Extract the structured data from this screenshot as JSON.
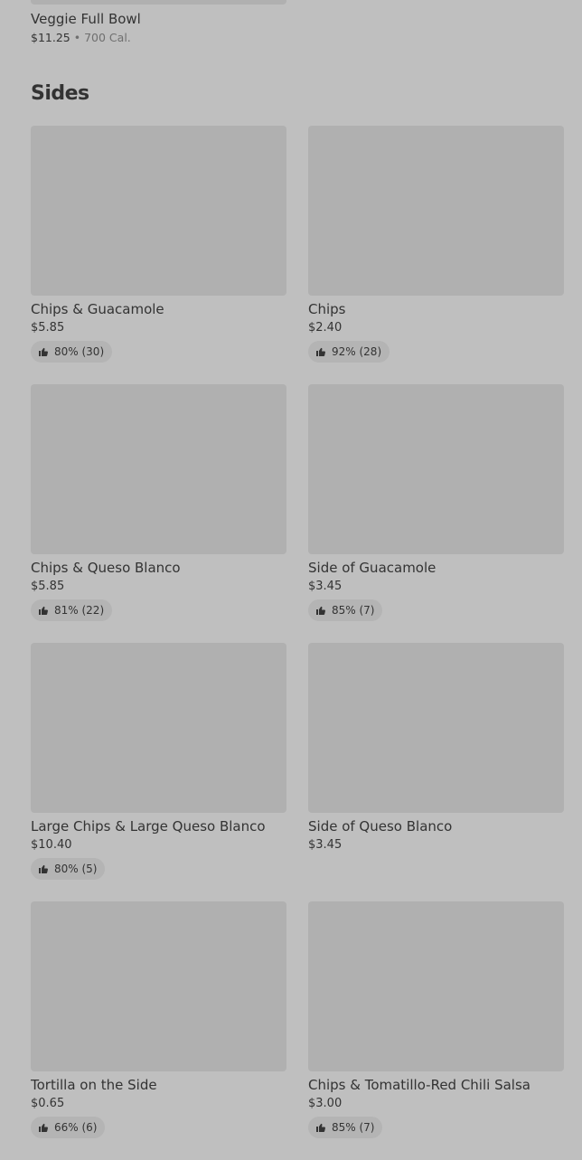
{
  "top_item": {
    "name": "Veggie Full Bowl",
    "price": "$11.25",
    "separator": "•",
    "calories": "700 Cal."
  },
  "section": {
    "title": "Sides",
    "items": [
      {
        "name": "Chips & Guacamole",
        "price": "$5.85",
        "rating": "80% (30)"
      },
      {
        "name": "Chips",
        "price": "$2.40",
        "rating": "92% (28)"
      },
      {
        "name": "Chips & Queso Blanco",
        "price": "$5.85",
        "rating": "81% (22)"
      },
      {
        "name": "Side of Guacamole",
        "price": "$3.45",
        "rating": "85% (7)"
      },
      {
        "name": "Large Chips & Large Queso Blanco",
        "price": "$10.40",
        "rating": "80% (5)"
      },
      {
        "name": "Side of Queso Blanco",
        "price": "$3.45",
        "rating": null
      },
      {
        "name": "Tortilla on the Side",
        "price": "$0.65",
        "rating": "66% (6)"
      },
      {
        "name": "Chips & Tomatillo-Red Chili Salsa",
        "price": "$3.00",
        "rating": "85% (7)"
      }
    ]
  },
  "icons": {
    "rating_icon": "thumbs-up-icon"
  },
  "colors": {
    "background": "#bfbfbf",
    "image_placeholder": "#b0b0b0",
    "rating_pill": "#b4b4b4",
    "text": "#333333",
    "muted_text": "#6f6f6f"
  }
}
